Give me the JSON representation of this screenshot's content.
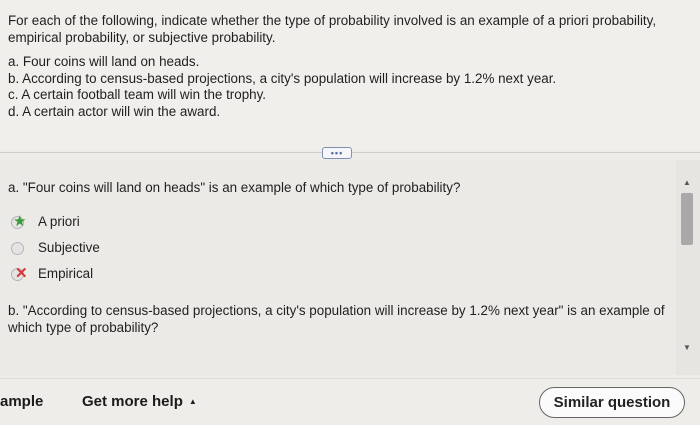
{
  "prompt": "For each of the following, indicate whether the type of probability involved is an example of a priori probability, empirical probability, or subjective probability.",
  "items": [
    "a. Four coins will land on heads.",
    "b. According to census-based projections, a city's population will increase by 1.2% next year.",
    "c. A certain football team will win the trophy.",
    "d. A certain actor will win the award."
  ],
  "more_button": "•••",
  "question_a": {
    "text": "a. \"Four coins will land on heads\" is an example of which type of probability?",
    "options": [
      {
        "label": "A priori",
        "state": "correct",
        "mark_icon": "green-star-icon"
      },
      {
        "label": "Subjective",
        "state": "unselected"
      },
      {
        "label": "Empirical",
        "state": "incorrect",
        "mark_icon": "red-x-icon"
      }
    ]
  },
  "question_b": {
    "text": "b. \"According to census-based projections, a city's population will increase by 1.2% next year\" is an example of which type of probability?"
  },
  "bottom": {
    "example_label": "ample",
    "help_label": "Get more help",
    "help_caret": "▲",
    "similar_label": "Similar question"
  },
  "colors": {
    "correct_mark": "#3a9a3a",
    "incorrect_mark": "#d23a3a",
    "pill_border": "#7f8fb5"
  }
}
